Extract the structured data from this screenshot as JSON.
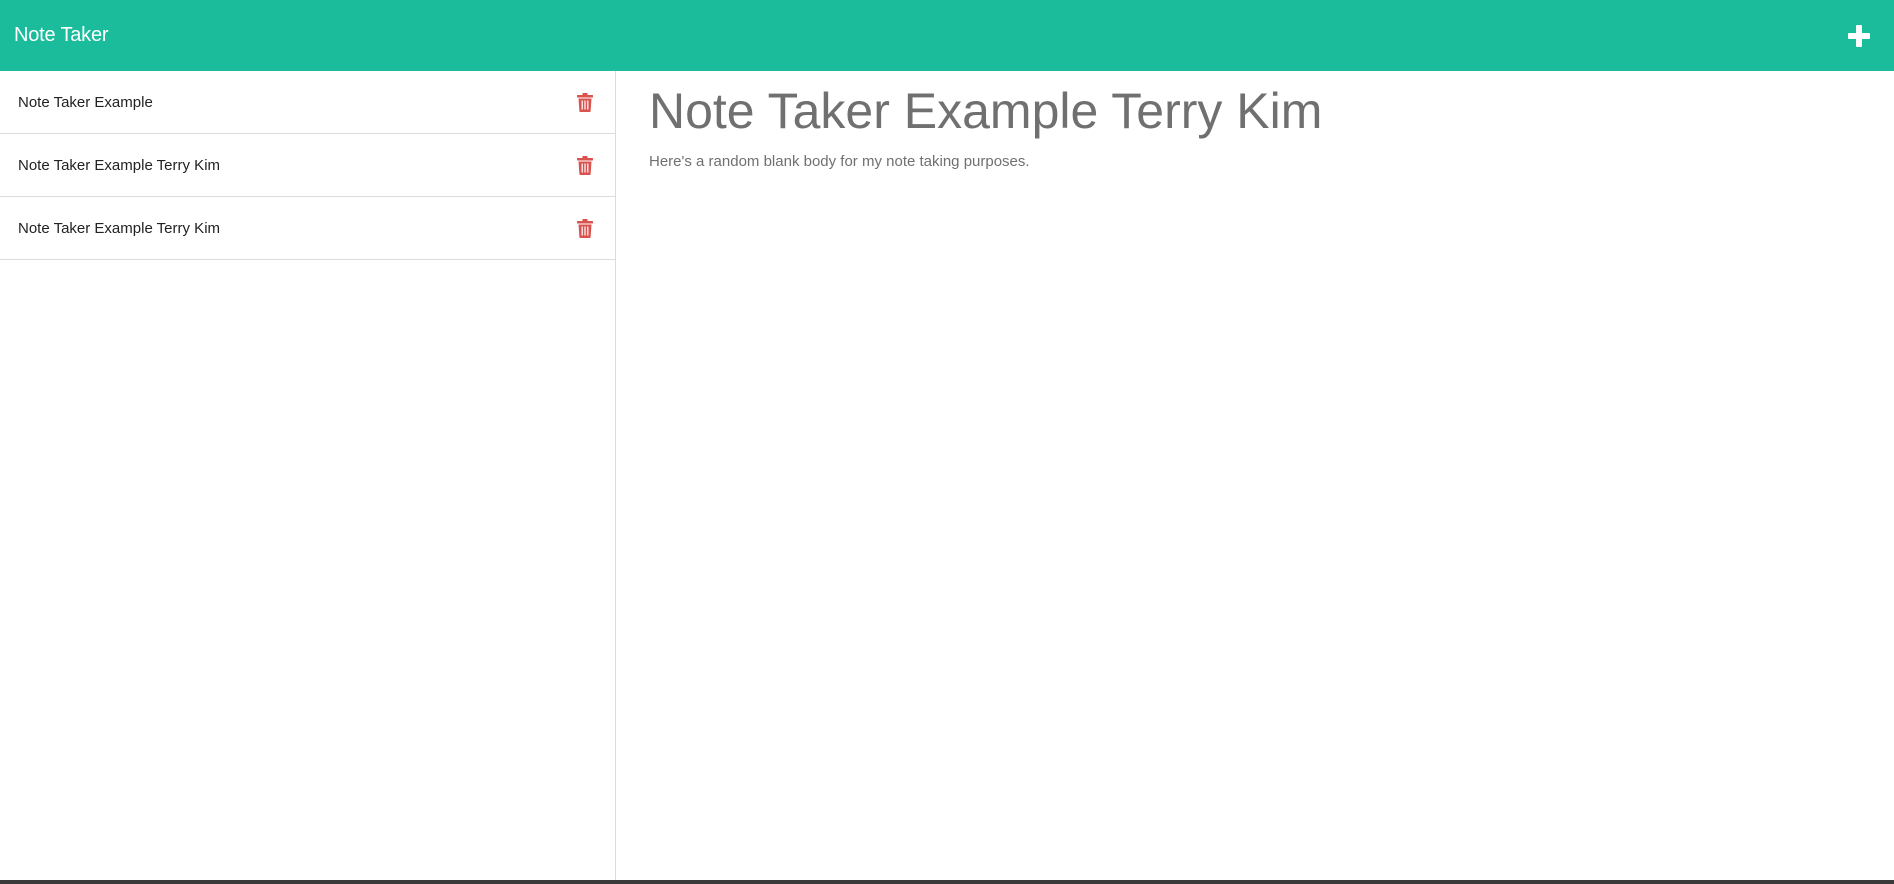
{
  "app": {
    "title": "Note Taker"
  },
  "toolbar": {
    "new_note_icon": "plus-icon"
  },
  "notes": [
    {
      "title": "Note Taker Example",
      "delete_icon": "trash-icon"
    },
    {
      "title": "Note Taker Example Terry Kim",
      "delete_icon": "trash-icon"
    },
    {
      "title": "Note Taker Example Terry Kim",
      "delete_icon": "trash-icon"
    }
  ],
  "editor": {
    "title_value": "Note Taker Example Terry Kim",
    "body_value": "Here's a random blank body for my note taking purposes."
  },
  "colors": {
    "navbar": "#1abc9c",
    "delete_icon": "#d9534f",
    "editor_text": "#707070"
  }
}
